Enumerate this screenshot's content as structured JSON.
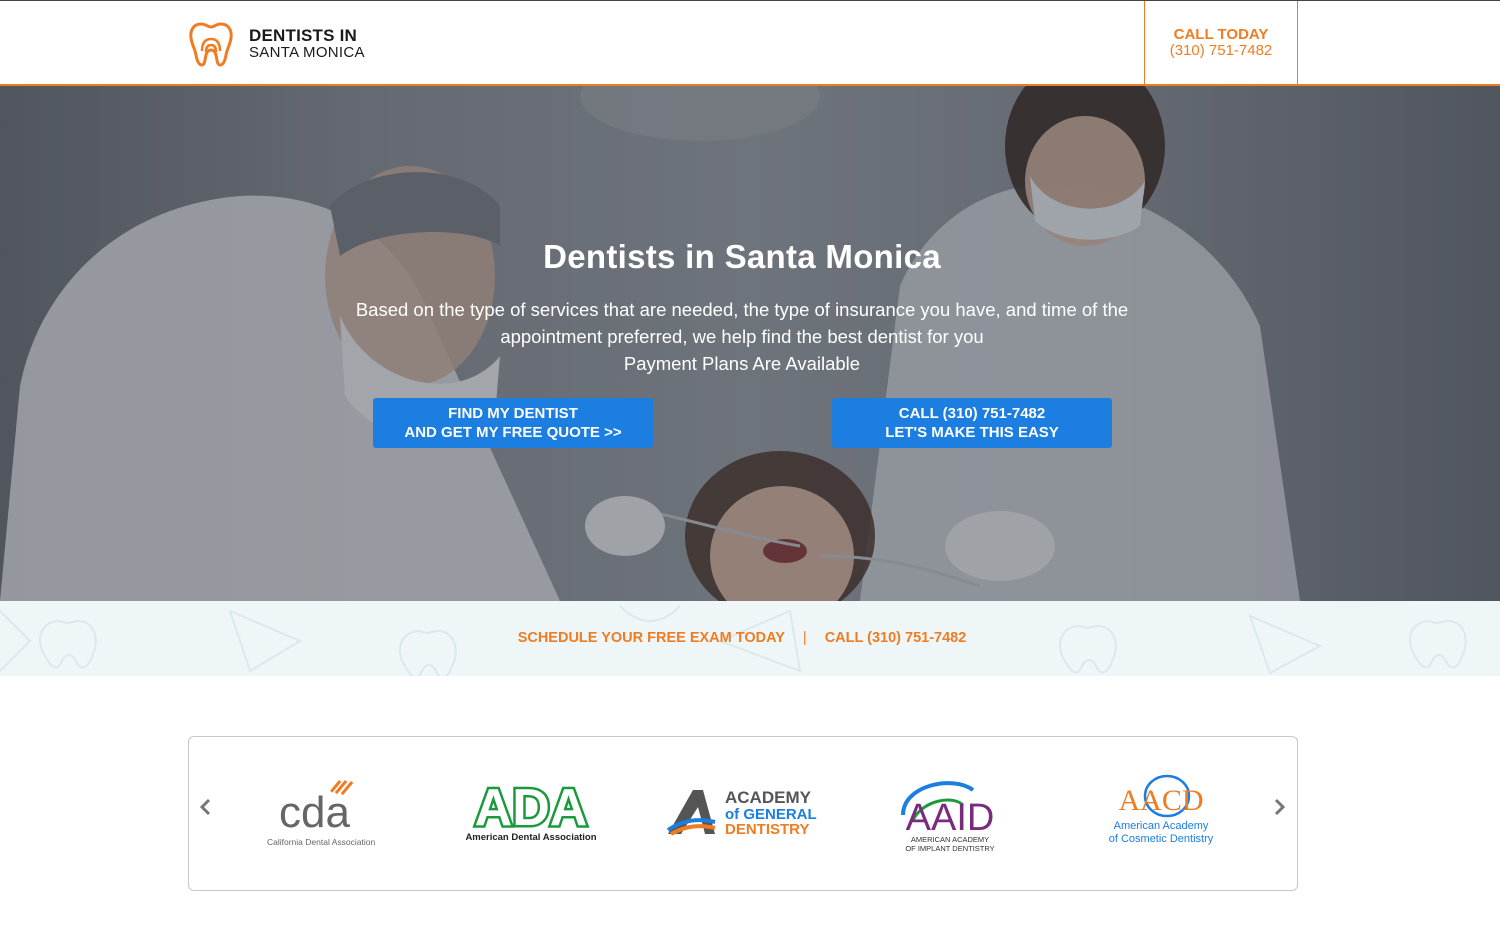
{
  "header": {
    "logo_line1": "DENTISTS IN",
    "logo_line2": "SANTA MONICA",
    "call_label": "CALL TODAY",
    "call_phone": "(310) 751-7482"
  },
  "hero": {
    "title": "Dentists in Santa Monica",
    "subtitle_line1": "Based on the type of services that are needed, the type of insurance you have, and time of the",
    "subtitle_line2": "appointment preferred, we help find the best dentist for you",
    "subtitle_line3": "Payment Plans Are Available",
    "btn_find_line1": "FIND MY DENTIST",
    "btn_find_line2": "AND GET MY FREE QUOTE >>",
    "btn_call_line1": "CALL (310) 751-7482",
    "btn_call_line2": "LET'S MAKE THIS EASY"
  },
  "strip": {
    "schedule": "SCHEDULE YOUR FREE EXAM TODAY",
    "separator": "|",
    "call": "CALL (310) 751-7482"
  },
  "carousel": {
    "prev_icon": "chevron-left-icon",
    "next_icon": "chevron-right-icon",
    "logos": {
      "cda_mark": "cda",
      "cda_name": "California Dental Association",
      "ada_mark": "ADA",
      "ada_name": "American Dental Association",
      "agd_line1": "ACADEMY",
      "agd_line2": "of GENERAL",
      "agd_line3": "DENTISTRY",
      "aaid_mark": "AAID",
      "aaid_line1": "AMERICAN ACADEMY",
      "aaid_line2": "OF IMPLANT DENTISTRY",
      "aacd_mark": "AACD",
      "aacd_line1": "American Academy",
      "aacd_line2": "of Cosmetic Dentistry"
    }
  },
  "colors": {
    "accent": "#f07c22",
    "button": "#1b7ee0",
    "strip_bg": "#eef6f8"
  }
}
